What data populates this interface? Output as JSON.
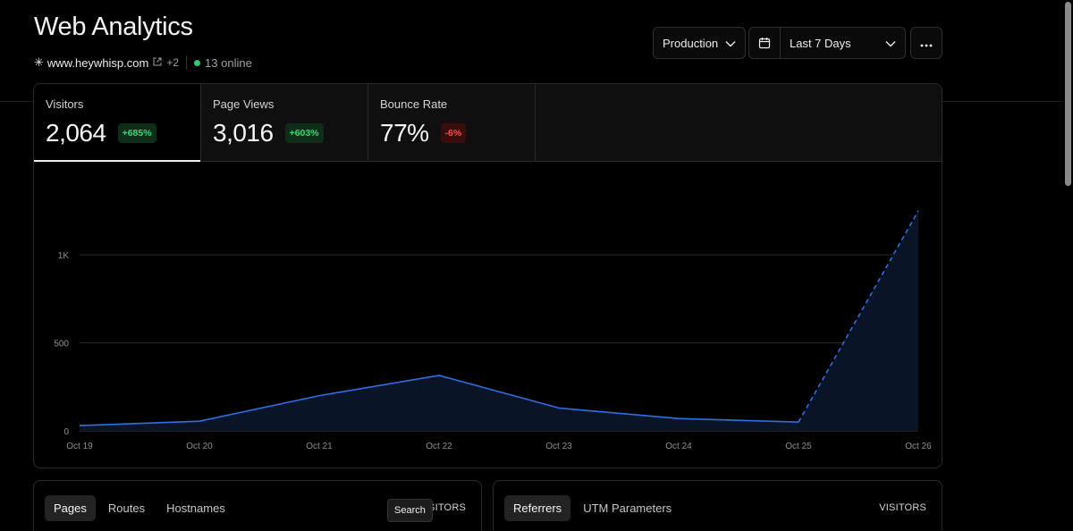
{
  "header": {
    "title": "Web Analytics",
    "domain": "www.heywhisp.com",
    "extra_domains": "+2",
    "online": "13 online"
  },
  "controls": {
    "environment": "Production",
    "date_range": "Last 7 Days"
  },
  "metrics": [
    {
      "label": "Visitors",
      "value": "2,064",
      "change": "+685%",
      "trend": "up",
      "active": true
    },
    {
      "label": "Page Views",
      "value": "3,016",
      "change": "+603%",
      "trend": "up",
      "active": false
    },
    {
      "label": "Bounce Rate",
      "value": "77%",
      "change": "-6%",
      "trend": "down",
      "active": false
    }
  ],
  "chart_data": {
    "type": "area",
    "title": "",
    "xlabel": "",
    "ylabel": "",
    "categories": [
      "Oct 19",
      "Oct 20",
      "Oct 21",
      "Oct 22",
      "Oct 23",
      "Oct 24",
      "Oct 25",
      "Oct 26"
    ],
    "series": [
      {
        "values": [
          30,
          55,
          200,
          315,
          130,
          70,
          50,
          1250
        ],
        "style": "solid, last segment dashed"
      }
    ],
    "yticks": [
      "0",
      "500",
      "1K"
    ],
    "ylim": [
      0,
      1000
    ],
    "grid": true,
    "line_color": "#2f6fe6",
    "fill_color": "#0a1628"
  },
  "bottom_left": {
    "tabs": [
      "Pages",
      "Routes",
      "Hostnames"
    ],
    "active_tab": "Pages",
    "column": "VISITORS",
    "tooltip": "Search"
  },
  "bottom_right": {
    "tabs": [
      "Referrers",
      "UTM Parameters"
    ],
    "active_tab": "Referrers",
    "column": "VISITORS"
  }
}
